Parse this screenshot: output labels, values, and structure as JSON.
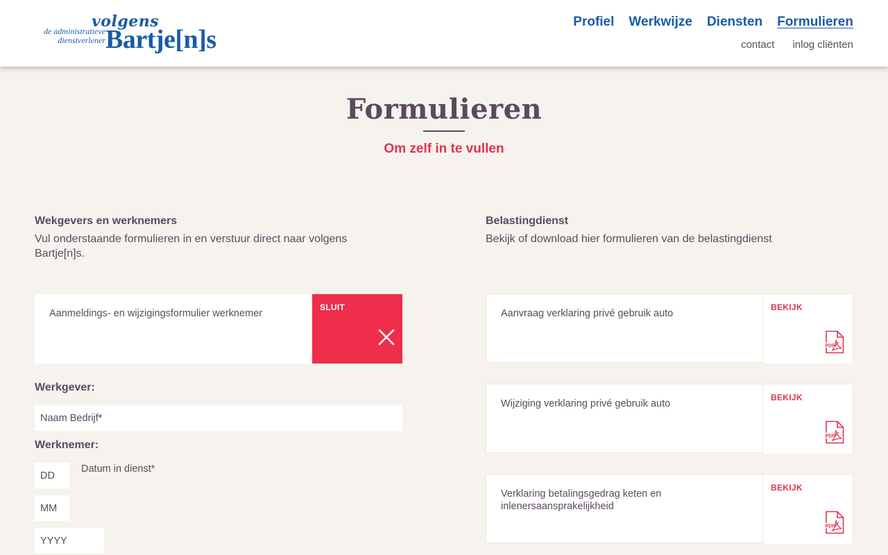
{
  "brand": {
    "line1": "volgens",
    "line2a": "de administratieve",
    "line2b": "dienstverlener",
    "line3": "Bartje[n]s"
  },
  "nav": {
    "main": [
      "Profiel",
      "Werkwijze",
      "Diensten",
      "Formulieren"
    ],
    "active": "Formulieren",
    "sub": [
      "contact",
      "inlog cliënten"
    ]
  },
  "hero": {
    "title": "Formulieren",
    "subtitle": "Om zelf in te vullen"
  },
  "left": {
    "heading": "Wekgevers en werknemers",
    "description": "Vul onderstaande formulieren in en verstuur direct naar volgens Bartje[n]s.",
    "card": {
      "label": "Aanmeldings- en wijzigingsformulier werknemer",
      "action": "SLUIT",
      "icon": "close-icon"
    },
    "form": {
      "employer_label": "Werkgever:",
      "company_placeholder": "Naam Bedrijf*",
      "employee_label": "Werknemer:",
      "day_placeholder": "DD",
      "month_placeholder": "MM",
      "year_placeholder": "YYYY",
      "date_note": "Datum in dienst*"
    }
  },
  "right": {
    "heading": "Belastingdienst",
    "description": "Bekijk of download hier formulieren van de belastingdienst",
    "cards": [
      {
        "label": "Aanvraag verklaring privé gebruik auto",
        "action": "BEKIJK",
        "icon": "pdf-icon"
      },
      {
        "label": "Wijziging verklaring privé gebruik auto",
        "action": "BEKIJK",
        "icon": "pdf-icon"
      },
      {
        "label": "Verklaring betalingsgedrag keten en inlenersaansprakelijkheid",
        "action": "BEKIJK",
        "icon": "pdf-icon"
      }
    ]
  },
  "colors": {
    "brand_blue": "#1a5ba6",
    "accent_red": "#ee2e4b",
    "text_plum": "#5b4a5e",
    "background": "#f6f3ee"
  }
}
